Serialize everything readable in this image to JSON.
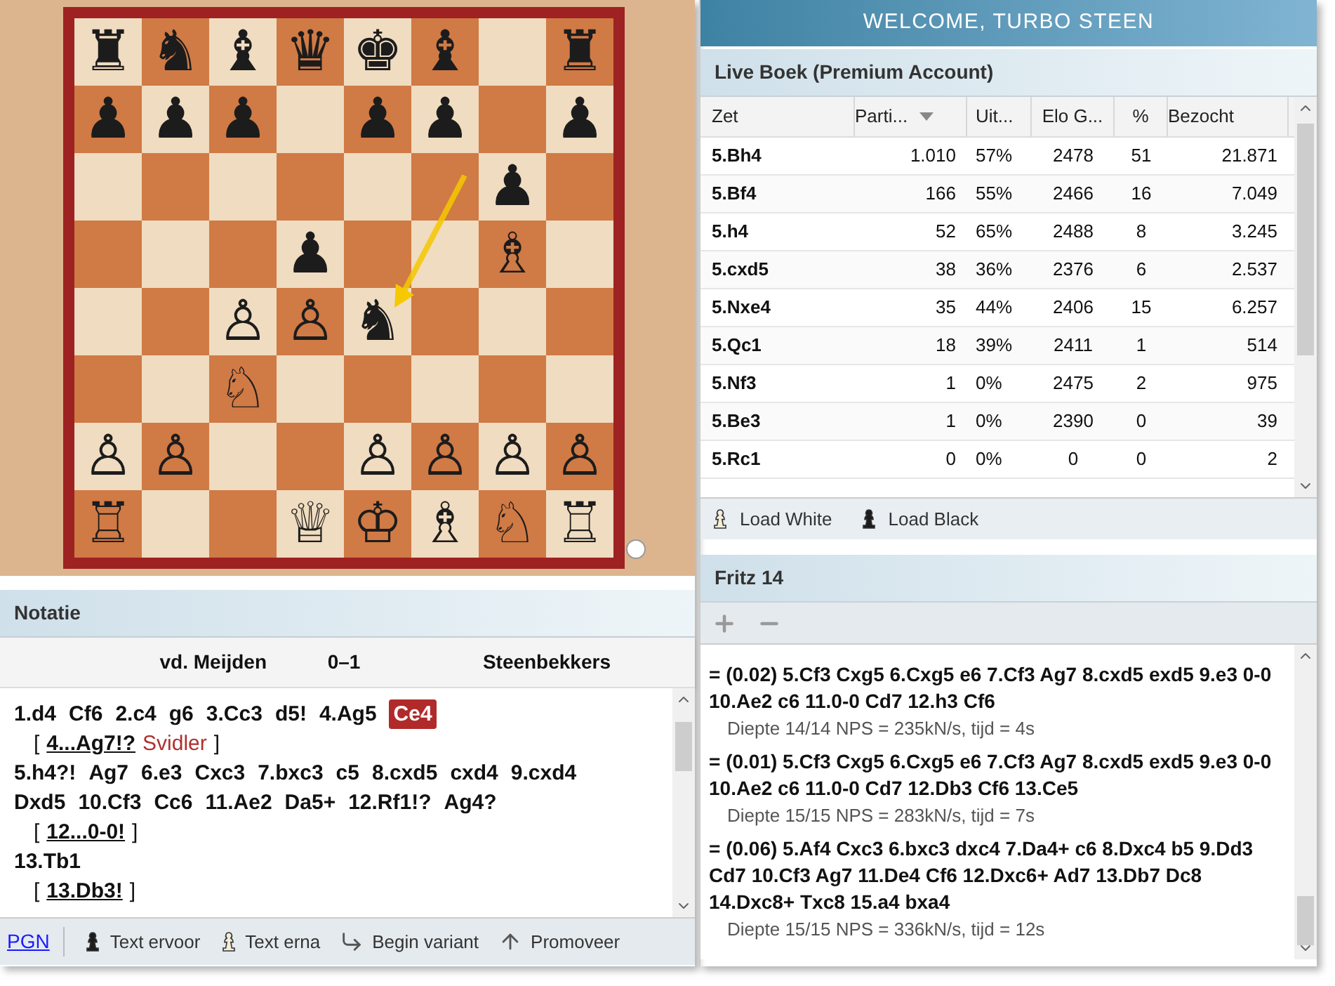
{
  "board": {
    "ranks": [
      [
        {
          "kind": "piece",
          "glyph": "♜"
        },
        {
          "kind": "piece",
          "glyph": "♞"
        },
        {
          "kind": "piece",
          "glyph": "♝"
        },
        {
          "kind": "piece",
          "glyph": "♛"
        },
        {
          "kind": "piece",
          "glyph": "♚"
        },
        {
          "kind": "piece",
          "glyph": "♝"
        },
        {
          "kind": "empty"
        },
        {
          "kind": "piece",
          "glyph": "♜"
        }
      ],
      [
        {
          "kind": "piece",
          "glyph": "♟"
        },
        {
          "kind": "piece",
          "glyph": "♟"
        },
        {
          "kind": "piece",
          "glyph": "♟"
        },
        {
          "kind": "empty"
        },
        {
          "kind": "piece",
          "glyph": "♟"
        },
        {
          "kind": "piece",
          "glyph": "♟"
        },
        {
          "kind": "empty"
        },
        {
          "kind": "piece",
          "glyph": "♟"
        }
      ],
      [
        {
          "kind": "empty"
        },
        {
          "kind": "empty"
        },
        {
          "kind": "empty"
        },
        {
          "kind": "empty"
        },
        {
          "kind": "empty"
        },
        {
          "kind": "empty"
        },
        {
          "kind": "piece",
          "glyph": "♟"
        },
        {
          "kind": "empty"
        }
      ],
      [
        {
          "kind": "empty"
        },
        {
          "kind": "empty"
        },
        {
          "kind": "empty"
        },
        {
          "kind": "piece",
          "glyph": "♟"
        },
        {
          "kind": "empty"
        },
        {
          "kind": "empty"
        },
        {
          "kind": "piece",
          "glyph": "♗"
        },
        {
          "kind": "empty"
        }
      ],
      [
        {
          "kind": "empty"
        },
        {
          "kind": "empty"
        },
        {
          "kind": "piece",
          "glyph": "♙"
        },
        {
          "kind": "piece",
          "glyph": "♙"
        },
        {
          "kind": "piece",
          "glyph": "♞"
        },
        {
          "kind": "empty"
        },
        {
          "kind": "empty"
        },
        {
          "kind": "empty"
        }
      ],
      [
        {
          "kind": "empty"
        },
        {
          "kind": "empty"
        },
        {
          "kind": "piece",
          "glyph": "♘"
        },
        {
          "kind": "empty"
        },
        {
          "kind": "empty"
        },
        {
          "kind": "empty"
        },
        {
          "kind": "empty"
        },
        {
          "kind": "empty"
        }
      ],
      [
        {
          "kind": "piece",
          "glyph": "♙"
        },
        {
          "kind": "piece",
          "glyph": "♙"
        },
        {
          "kind": "empty"
        },
        {
          "kind": "empty"
        },
        {
          "kind": "piece",
          "glyph": "♙"
        },
        {
          "kind": "piece",
          "glyph": "♙"
        },
        {
          "kind": "piece",
          "glyph": "♙"
        },
        {
          "kind": "piece",
          "glyph": "♙"
        }
      ],
      [
        {
          "kind": "piece",
          "glyph": "♖"
        },
        {
          "kind": "empty"
        },
        {
          "kind": "empty"
        },
        {
          "kind": "piece",
          "glyph": "♕"
        },
        {
          "kind": "piece",
          "glyph": "♔"
        },
        {
          "kind": "piece",
          "glyph": "♗"
        },
        {
          "kind": "piece",
          "glyph": "♘"
        },
        {
          "kind": "piece",
          "glyph": "♖"
        }
      ]
    ]
  },
  "notation": {
    "title": "Notatie",
    "white": "vd. Meijden",
    "result": "0–1",
    "black": "Steenbekkers",
    "lines": [
      {
        "kind": "main",
        "tokens": [
          {
            "text": "1.d4",
            "selected": false
          },
          {
            "text": "Cf6",
            "selected": false
          },
          {
            "text": "2.c4",
            "selected": false
          },
          {
            "text": "g6",
            "selected": false
          },
          {
            "text": "3.Cc3",
            "selected": false
          },
          {
            "text": "d5!",
            "selected": false
          },
          {
            "text": "4.Ag5",
            "selected": false
          },
          {
            "text": "Ce4",
            "selected": true
          }
        ]
      },
      {
        "kind": "variation",
        "open": "[",
        "move": "4...Ag7!?",
        "comment": "Svidler",
        "close": "]"
      },
      {
        "kind": "main",
        "tokens": [
          {
            "text": "5.h4?!",
            "selected": false
          },
          {
            "text": "Ag7",
            "selected": false
          },
          {
            "text": "6.e3",
            "selected": false
          },
          {
            "text": "Cxc3",
            "selected": false
          },
          {
            "text": "7.bxc3",
            "selected": false
          },
          {
            "text": "c5",
            "selected": false
          },
          {
            "text": "8.cxd5",
            "selected": false
          },
          {
            "text": "cxd4",
            "selected": false
          },
          {
            "text": "9.cxd4",
            "selected": false
          }
        ]
      },
      {
        "kind": "main",
        "tokens": [
          {
            "text": "Dxd5",
            "selected": false
          },
          {
            "text": "10.Cf3",
            "selected": false
          },
          {
            "text": "Cc6",
            "selected": false
          },
          {
            "text": "11.Ae2",
            "selected": false
          },
          {
            "text": "Da5+",
            "selected": false
          },
          {
            "text": "12.Rf1!?",
            "selected": false
          },
          {
            "text": "Ag4?",
            "selected": false
          }
        ]
      },
      {
        "kind": "variation",
        "open": "[",
        "move": "12...0-0!",
        "close": "]"
      },
      {
        "kind": "main",
        "tokens": [
          {
            "text": "13.Tb1",
            "selected": false
          }
        ]
      },
      {
        "kind": "variation",
        "open": "[",
        "move": "13.Db3!",
        "close": "]"
      }
    ],
    "toolbar": [
      {
        "kind": "link",
        "label": "PGN"
      },
      {
        "kind": "before",
        "label": "Text ervoor"
      },
      {
        "kind": "after",
        "label": "Text erna"
      },
      {
        "kind": "variant",
        "label": "Begin variant"
      },
      {
        "kind": "promote",
        "label": "Promoveer"
      }
    ]
  },
  "welcome": "WELCOME, TURBO STEEN",
  "book": {
    "title": "Live Boek (Premium Account)",
    "columns": [
      {
        "label": "Zet",
        "sorted": false
      },
      {
        "label": "Parti...",
        "sorted": true
      },
      {
        "label": "Uit...",
        "sorted": false
      },
      {
        "label": "Elo G...",
        "sorted": false
      },
      {
        "label": "%",
        "sorted": false
      },
      {
        "label": "Bezocht",
        "sorted": false
      }
    ],
    "rows": [
      [
        "5.Bh4",
        "1.010",
        "57%",
        "2478",
        "51",
        "21.871"
      ],
      [
        "5.Bf4",
        "166",
        "55%",
        "2466",
        "16",
        "7.049"
      ],
      [
        "5.h4",
        "52",
        "65%",
        "2488",
        "8",
        "3.245"
      ],
      [
        "5.cxd5",
        "38",
        "36%",
        "2376",
        "6",
        "2.537"
      ],
      [
        "5.Nxe4",
        "35",
        "44%",
        "2406",
        "15",
        "6.257"
      ],
      [
        "5.Qc1",
        "18",
        "39%",
        "2411",
        "1",
        "514"
      ],
      [
        "5.Nf3",
        "1",
        "0%",
        "2475",
        "2",
        "975"
      ],
      [
        "5.Be3",
        "1",
        "0%",
        "2390",
        "0",
        "39"
      ],
      [
        "5.Rc1",
        "0",
        "0%",
        "0",
        "0",
        "2"
      ]
    ],
    "buttons": [
      {
        "kind": "white",
        "label": "Load White"
      },
      {
        "kind": "black",
        "label": "Load Black"
      }
    ]
  },
  "engine": {
    "title": "Fritz 14",
    "lines": [
      {
        "line": "= (0.02) 5.Cf3 Cxg5 6.Cxg5 e6 7.Cf3 Ag7 8.cxd5 exd5 9.e3 0-0 10.Ae2 c6 11.0-0 Cd7 12.h3 Cf6",
        "info": "Diepte 14/14 NPS = 235kN/s, tijd = 4s"
      },
      {
        "line": "= (0.01) 5.Cf3 Cxg5 6.Cxg5 e6 7.Cf3 Ag7 8.cxd5 exd5 9.e3 0-0 10.Ae2 c6 11.0-0 Cd7 12.Db3 Cf6 13.Ce5",
        "info": "Diepte 15/15 NPS = 283kN/s, tijd = 7s"
      },
      {
        "line": "= (0.06) 5.Af4 Cxc3 6.bxc3 dxc4 7.Da4+ c6 8.Dxc4 b5 9.Dd3 Cd7 10.Cf3 Ag7 11.De4 Cf6 12.Dxc6+ Ad7 13.Db7 Dc8 14.Dxc8+ Txc8 15.a4 bxa4",
        "info": "Diepte 15/15 NPS = 336kN/s, tijd = 12s"
      }
    ]
  }
}
